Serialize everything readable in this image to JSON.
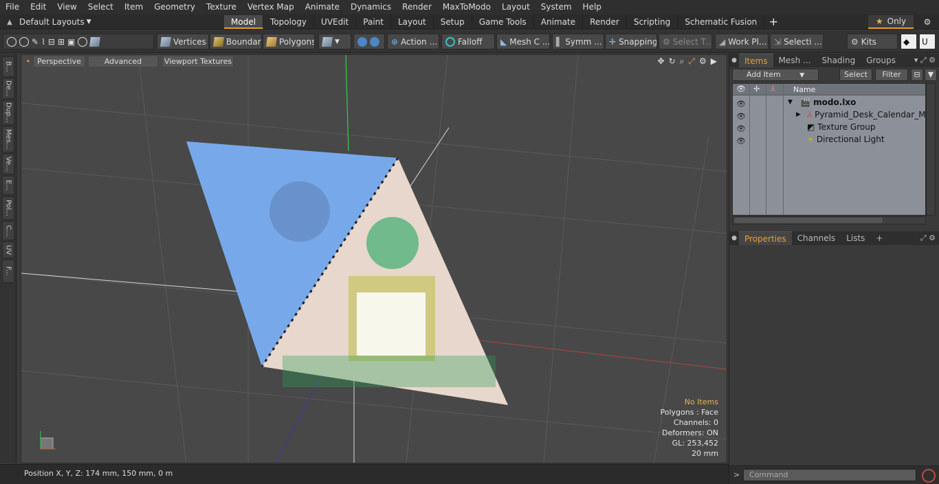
{
  "menu": [
    "File",
    "Edit",
    "View",
    "Select",
    "Item",
    "Geometry",
    "Texture",
    "Vertex Map",
    "Animate",
    "Dynamics",
    "Render",
    "MaxToModo",
    "Layout",
    "System",
    "Help"
  ],
  "layouts_label": "Default Layouts",
  "tabs": [
    "Model",
    "Topology",
    "UVEdit",
    "Paint",
    "Layout",
    "Setup",
    "Game Tools",
    "Animate",
    "Render",
    "Scripting",
    "Schematic Fusion"
  ],
  "active_tab": "Model",
  "only_label": "Only",
  "toolbar": {
    "vertices": "Vertices",
    "boundary": "Boundary",
    "polygons": "Polygons",
    "action": "Action",
    "falloff": "Falloff",
    "mesh_c": "Mesh C ...",
    "symm": "Symm ...",
    "snapping": "Snapping",
    "select_t": "Select T...",
    "work_pl": "Work Pl...",
    "selecti": "Selecti ...",
    "kits": "Kits"
  },
  "left_tabs": [
    "B...",
    "De...",
    "Dup...",
    "Mes...",
    "Ve...",
    "E...",
    "Pol...",
    "C...",
    "UV",
    "F..."
  ],
  "viewport": {
    "perspective": "Perspective",
    "advanced": "Advanced",
    "viewport_textures": "Viewport Textures",
    "stats": {
      "items": "No Items",
      "polygons": "Polygons : Face",
      "channels": "Channels: 0",
      "deformers": "Deformers: ON",
      "gl": "GL: 253,452",
      "scale": "20 mm"
    }
  },
  "status_text": "Position X, Y, Z:   174 mm, 150 mm, 0 m",
  "right_panel": {
    "tabs": [
      "Items",
      "Mesh ...",
      "Shading",
      "Groups"
    ],
    "add_item": "Add Item",
    "select": "Select",
    "filter": "Filter",
    "name_header": "Name",
    "tree": [
      {
        "label": "modo.lxo",
        "depth": 0
      },
      {
        "label": "Pyramid_Desk_Calendar_Moc...",
        "depth": 1
      },
      {
        "label": "Texture Group",
        "depth": 1
      },
      {
        "label": "Directional Light",
        "depth": 1
      }
    ],
    "props_tabs": [
      "Properties",
      "Channels",
      "Lists"
    ],
    "command_placeholder": "Command"
  },
  "colors": {
    "accent": "#e5a13b",
    "calendar_blue": "#77a9ea",
    "calendar_pink": "#e7d7cc",
    "grid_green": "#2ecf4a"
  }
}
